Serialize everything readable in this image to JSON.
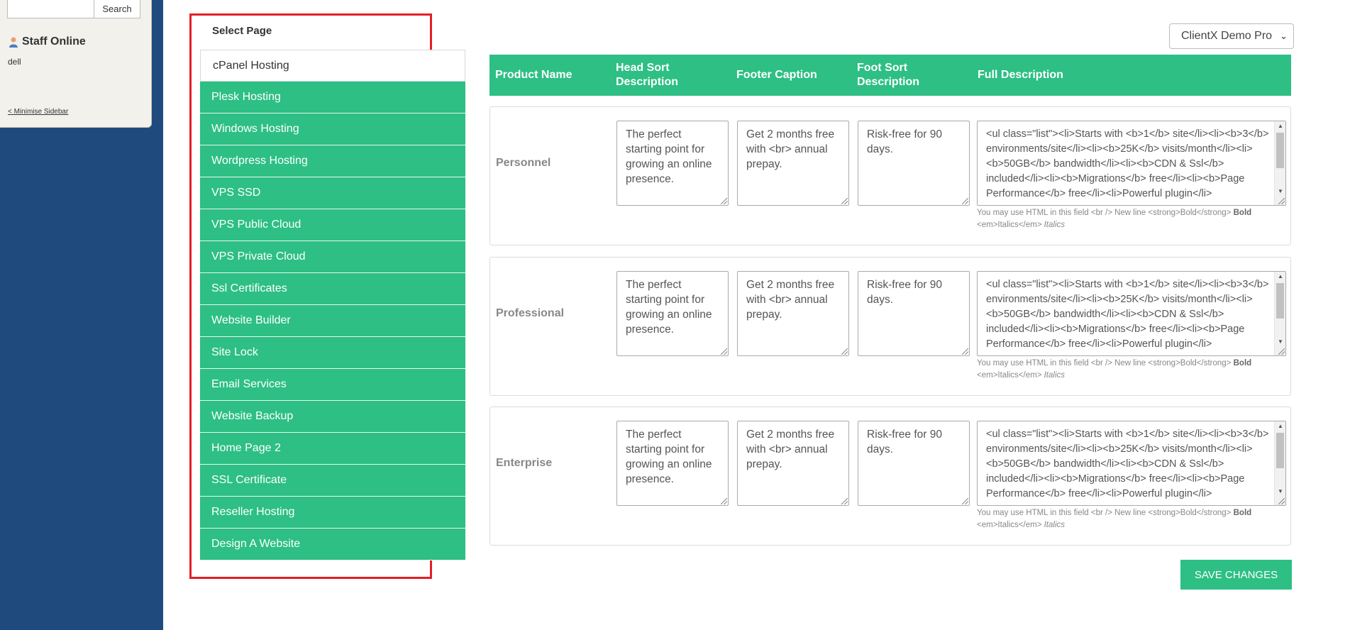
{
  "sidebar": {
    "search_button": "Search",
    "search_value": "",
    "staff_online_title": "Staff Online",
    "staff_online_users": [
      "dell"
    ],
    "minimise_link": "< Minimise Sidebar"
  },
  "select_page": {
    "title": "Select Page",
    "items": [
      {
        "label": "cPanel Hosting",
        "active": true
      },
      {
        "label": "Plesk Hosting"
      },
      {
        "label": "Windows Hosting"
      },
      {
        "label": "Wordpress Hosting"
      },
      {
        "label": "VPS SSD"
      },
      {
        "label": "VPS Public Cloud"
      },
      {
        "label": "VPS Private Cloud"
      },
      {
        "label": "Ssl Certificates"
      },
      {
        "label": "Website Builder"
      },
      {
        "label": "Site Lock"
      },
      {
        "label": "Email Services"
      },
      {
        "label": "Website Backup"
      },
      {
        "label": "Home Page 2"
      },
      {
        "label": "SSL Certificate"
      },
      {
        "label": "Reseller Hosting"
      },
      {
        "label": "Design A Website"
      }
    ]
  },
  "client_select": {
    "selected": "ClientX Demo Pro"
  },
  "table": {
    "headers": {
      "product_name": "Product Name",
      "head_sort_description": "Head Sort Description",
      "footer_caption": "Footer Caption",
      "foot_sort_description": "Foot Sort Description",
      "full_description": "Full Description"
    },
    "rows": [
      {
        "name": "Personnel",
        "head_sort": "The perfect starting point for growing an online presence.",
        "footer_caption": "Get 2 months free with <br> annual prepay.",
        "foot_sort": "Risk-free for 90 days.",
        "full_description": "<ul class=\"list\"><li>Starts with <b>1</b> site</li><li><b>3</b> environments/site</li><li><b>25K</b> visits/month</li><li><b>50GB</b> bandwidth</li><li><b>CDN & Ssl</b> included</li><li><b>Migrations</b> free</li><li><b>Page Performance</b> free</li><li>Powerful plugin</li>"
      },
      {
        "name": "Professional",
        "head_sort": "The perfect starting point for growing an online presence.",
        "footer_caption": "Get 2 months free with <br> annual prepay.",
        "foot_sort": "Risk-free for 90 days.",
        "full_description": "<ul class=\"list\"><li>Starts with <b>1</b> site</li><li><b>3</b> environments/site</li><li><b>25K</b> visits/month</li><li><b>50GB</b> bandwidth</li><li><b>CDN & Ssl</b> included</li><li><b>Migrations</b> free</li><li><b>Page Performance</b> free</li><li>Powerful plugin</li>"
      },
      {
        "name": "Enterprise",
        "head_sort": "The perfect starting point for growing an online presence.",
        "footer_caption": "Get 2 months free with <br> annual prepay.",
        "foot_sort": "Risk-free for 90 days.",
        "full_description": "<ul class=\"list\"><li>Starts with <b>1</b> site</li><li><b>3</b> environments/site</li><li><b>25K</b> visits/month</li><li><b>50GB</b> bandwidth</li><li><b>CDN & Ssl</b> included</li><li><b>Migrations</b> free</li><li><b>Page Performance</b> free</li><li>Powerful plugin</li>"
      }
    ],
    "help_text": {
      "prefix": "You may use HTML in this field <br /> New line <strong>Bold</strong>",
      "bold": "Bold",
      "middle": "<em>Italics</em>",
      "italic": "Italics"
    }
  },
  "save_button": "SAVE CHANGES",
  "colors": {
    "accent_green": "#2dbf84",
    "sidebar_blue": "#1e4a7e",
    "highlight_red": "#e41e26"
  }
}
